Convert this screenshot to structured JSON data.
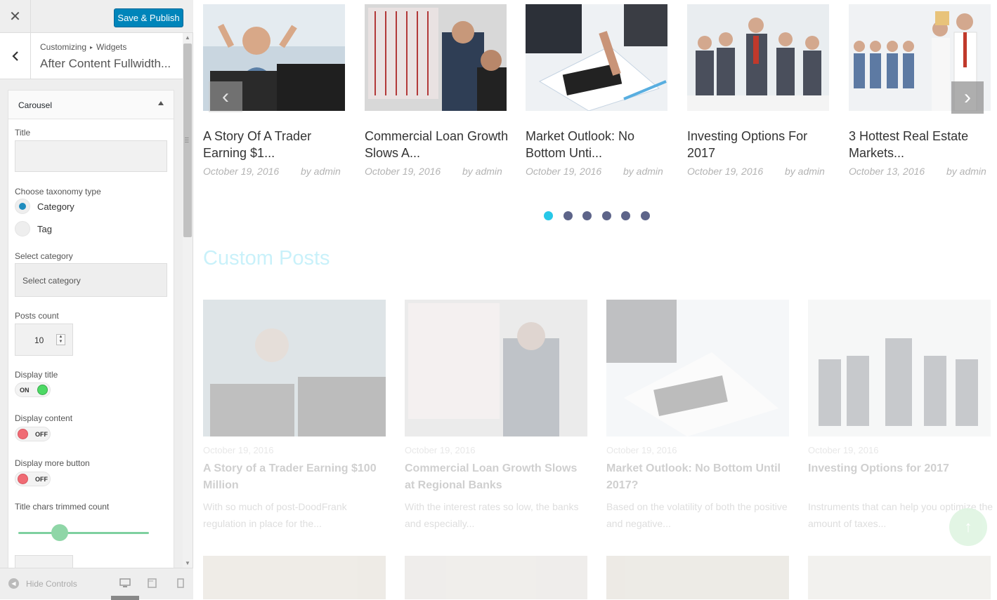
{
  "topbar": {
    "close_icon": "close-icon",
    "publish_label": "Save & Publish",
    "publish_color": "#0085ba"
  },
  "section": {
    "crumb_parent": "Customizing",
    "crumb_child": "Widgets",
    "title": "After Content Fullwidth..."
  },
  "widget": {
    "name": "Carousel",
    "title_label": "Title",
    "title_value": "",
    "taxonomy_label": "Choose taxonomy type",
    "taxonomy_options": [
      "Category",
      "Tag"
    ],
    "taxonomy_selected": "Category",
    "category_label": "Select category",
    "category_value": "Select category",
    "posts_count_label": "Posts count",
    "posts_count": "10",
    "display_title_label": "Display title",
    "display_title_state": "ON",
    "display_content_label": "Display content",
    "display_content_state": "OFF",
    "display_more_label": "Display more button",
    "display_more_state": "OFF",
    "title_chars_label": "Title chars trimmed count"
  },
  "footer": {
    "hide_controls": "Hide Controls",
    "devices": [
      "desktop-icon",
      "tablet-icon",
      "mobile-icon"
    ]
  },
  "carousel": {
    "items": [
      {
        "title": "A Story Of A Trader Earning $1...",
        "date": "October 19, 2016",
        "author": "by admin"
      },
      {
        "title": "Commercial Loan Growth Slows A...",
        "date": "October 19, 2016",
        "author": "by admin"
      },
      {
        "title": "Market Outlook: No Bottom Unti...",
        "date": "October 19, 2016",
        "author": "by admin"
      },
      {
        "title": "Investing Options For 2017",
        "date": "October 19, 2016",
        "author": "by admin"
      },
      {
        "title": "3 Hottest Real Estate Markets...",
        "date": "October 13, 2016",
        "author": "by admin"
      }
    ],
    "dots": 6,
    "active_dot": 0,
    "active_color": "#27c8e8",
    "dot_color": "#5d6489"
  },
  "custom_posts": {
    "heading": "Custom Posts",
    "posts": [
      {
        "date": "October 19, 2016",
        "title": "A Story of a Trader Earning $100 Million",
        "excerpt": "With so much of post-DoodFrank regulation in place for the..."
      },
      {
        "date": "October 19, 2016",
        "title": "Commercial Loan Growth Slows at Regional Banks",
        "excerpt": "With the interest rates so low, the banks and especially..."
      },
      {
        "date": "October 19, 2016",
        "title": "Market Outlook: No Bottom Until 2017?",
        "excerpt": "Based on the volatility of both the positive and negative..."
      },
      {
        "date": "October 19, 2016",
        "title": "Investing Options for 2017",
        "excerpt": "Instruments that can help you optimize the amount of taxes..."
      }
    ]
  }
}
